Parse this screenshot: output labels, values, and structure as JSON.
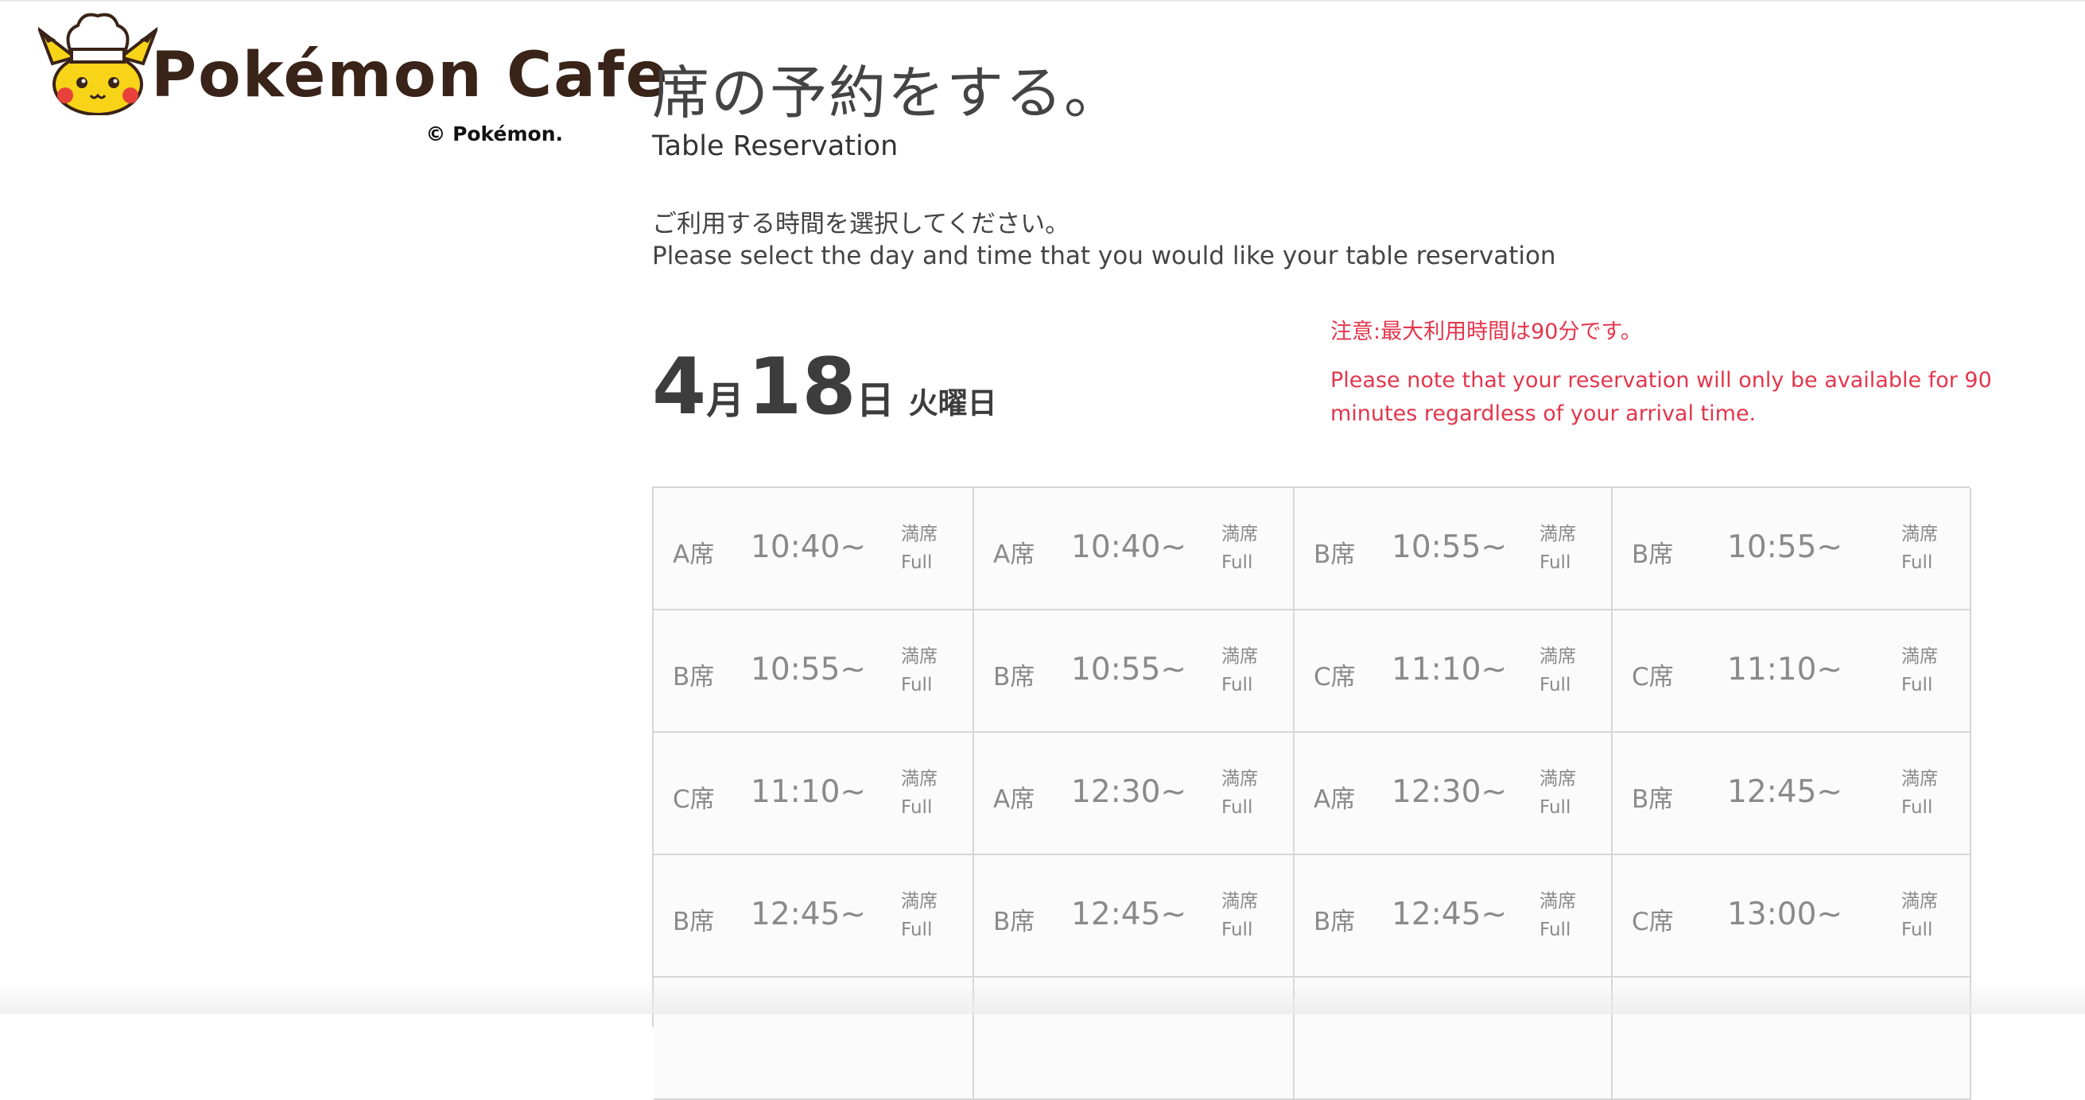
{
  "logo": {
    "wordmark": "Pokémon Cafe",
    "copyright": "© Pokémon."
  },
  "header": {
    "title_ja": "席の予約をする。",
    "title_en": "Table Reservation",
    "intro_ja": "ご利用する時間を選択してください。",
    "intro_en": "Please select the day and time that you would like your table reservation"
  },
  "date": {
    "month": "4",
    "month_unit": "月",
    "day": "18",
    "day_unit": "日",
    "weekday": "火曜日"
  },
  "notice": {
    "ja": "注意:最大利用時間は90分です。",
    "en": "Please note that your reservation will only be available for 90 minutes regardless of your arrival time."
  },
  "colors": {
    "accent_red": "#e2364c",
    "logo_brown": "#3a2318",
    "pikachu_yellow": "#f7d417",
    "grid_border": "#d6d6d6"
  },
  "slots": [
    {
      "seat": "A席",
      "time": "10:40~",
      "status_ja": "満席",
      "status_en": "Full"
    },
    {
      "seat": "A席",
      "time": "10:40~",
      "status_ja": "満席",
      "status_en": "Full"
    },
    {
      "seat": "B席",
      "time": "10:55~",
      "status_ja": "満席",
      "status_en": "Full"
    },
    {
      "seat": "B席",
      "time": "10:55~",
      "status_ja": "満席",
      "status_en": "Full"
    },
    {
      "seat": "B席",
      "time": "10:55~",
      "status_ja": "満席",
      "status_en": "Full"
    },
    {
      "seat": "B席",
      "time": "10:55~",
      "status_ja": "満席",
      "status_en": "Full"
    },
    {
      "seat": "C席",
      "time": "11:10~",
      "status_ja": "満席",
      "status_en": "Full"
    },
    {
      "seat": "C席",
      "time": "11:10~",
      "status_ja": "満席",
      "status_en": "Full"
    },
    {
      "seat": "C席",
      "time": "11:10~",
      "status_ja": "満席",
      "status_en": "Full"
    },
    {
      "seat": "A席",
      "time": "12:30~",
      "status_ja": "満席",
      "status_en": "Full"
    },
    {
      "seat": "A席",
      "time": "12:30~",
      "status_ja": "満席",
      "status_en": "Full"
    },
    {
      "seat": "B席",
      "time": "12:45~",
      "status_ja": "満席",
      "status_en": "Full"
    },
    {
      "seat": "B席",
      "time": "12:45~",
      "status_ja": "満席",
      "status_en": "Full"
    },
    {
      "seat": "B席",
      "time": "12:45~",
      "status_ja": "満席",
      "status_en": "Full"
    },
    {
      "seat": "B席",
      "time": "12:45~",
      "status_ja": "満席",
      "status_en": "Full"
    },
    {
      "seat": "C席",
      "time": "13:00~",
      "status_ja": "満席",
      "status_en": "Full"
    }
  ]
}
